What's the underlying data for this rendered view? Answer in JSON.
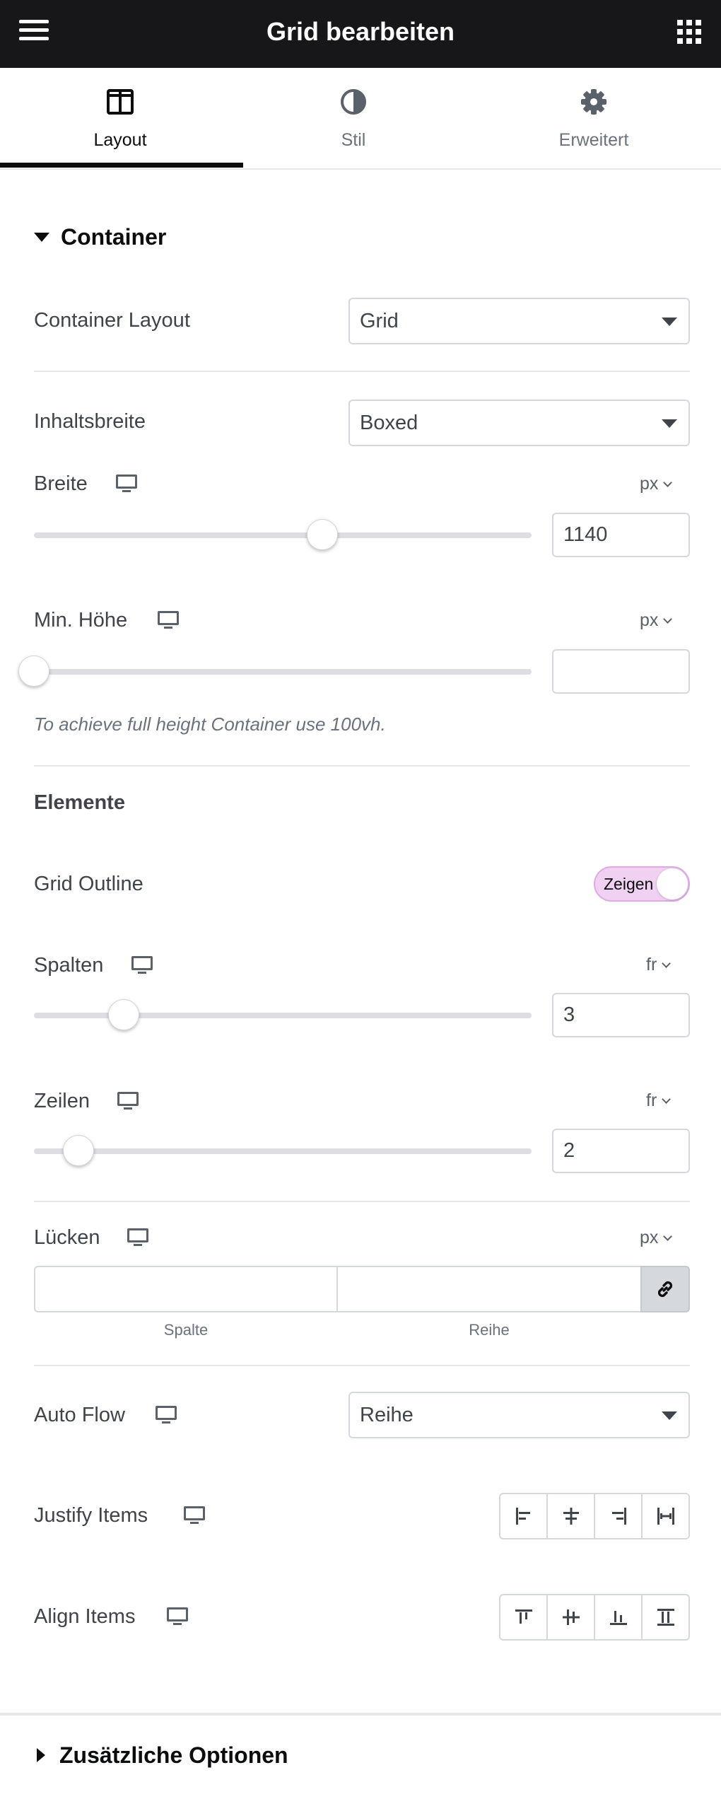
{
  "header": {
    "title": "Grid bearbeiten",
    "menu_icon": "hamburger-menu-icon",
    "apps_icon": "apps-grid-icon"
  },
  "tabs": [
    {
      "label": "Layout",
      "icon": "columns-layout-icon",
      "active": true
    },
    {
      "label": "Stil",
      "icon": "half-circle-contrast-icon",
      "active": false
    },
    {
      "label": "Erweitert",
      "icon": "gear-icon",
      "active": false
    }
  ],
  "section": {
    "title": "Container",
    "expanded": true
  },
  "container_layout": {
    "label": "Container Layout",
    "value": "Grid"
  },
  "content_width": {
    "label": "Inhaltsbreite",
    "value": "Boxed"
  },
  "width": {
    "label": "Breite",
    "unit": "px",
    "value": "1140",
    "slider_fraction": 0.58
  },
  "min_height": {
    "label": "Min. Höhe",
    "unit": "px",
    "value": "",
    "slider_fraction": 0.0,
    "hint": "To achieve full height Container use 100vh."
  },
  "elements": {
    "heading": "Elemente"
  },
  "grid_outline": {
    "label": "Grid Outline",
    "toggle_text": "Zeigen",
    "on": true
  },
  "columns": {
    "label": "Spalten",
    "unit": "fr",
    "value": "3",
    "slider_fraction": 0.18
  },
  "rows": {
    "label": "Zeilen",
    "unit": "fr",
    "value": "2",
    "slider_fraction": 0.09
  },
  "gaps": {
    "label": "Lücken",
    "unit": "px",
    "column_label": "Spalte",
    "row_label": "Reihe",
    "column_value": "",
    "row_value": ""
  },
  "auto_flow": {
    "label": "Auto Flow",
    "value": "Reihe"
  },
  "justify_items": {
    "label": "Justify Items",
    "options": [
      "justify-start-icon",
      "justify-center-icon",
      "justify-end-icon",
      "justify-stretch-icon"
    ]
  },
  "align_items": {
    "label": "Align Items",
    "options": [
      "align-start-icon",
      "align-center-icon",
      "align-end-icon",
      "align-stretch-icon"
    ]
  },
  "additional_options": {
    "title": "Zusätzliche Optionen",
    "expanded": false
  },
  "colors": {
    "topbar": "#17171a",
    "toggle_bg": "#f0d1f2",
    "text": "#3f444b"
  }
}
